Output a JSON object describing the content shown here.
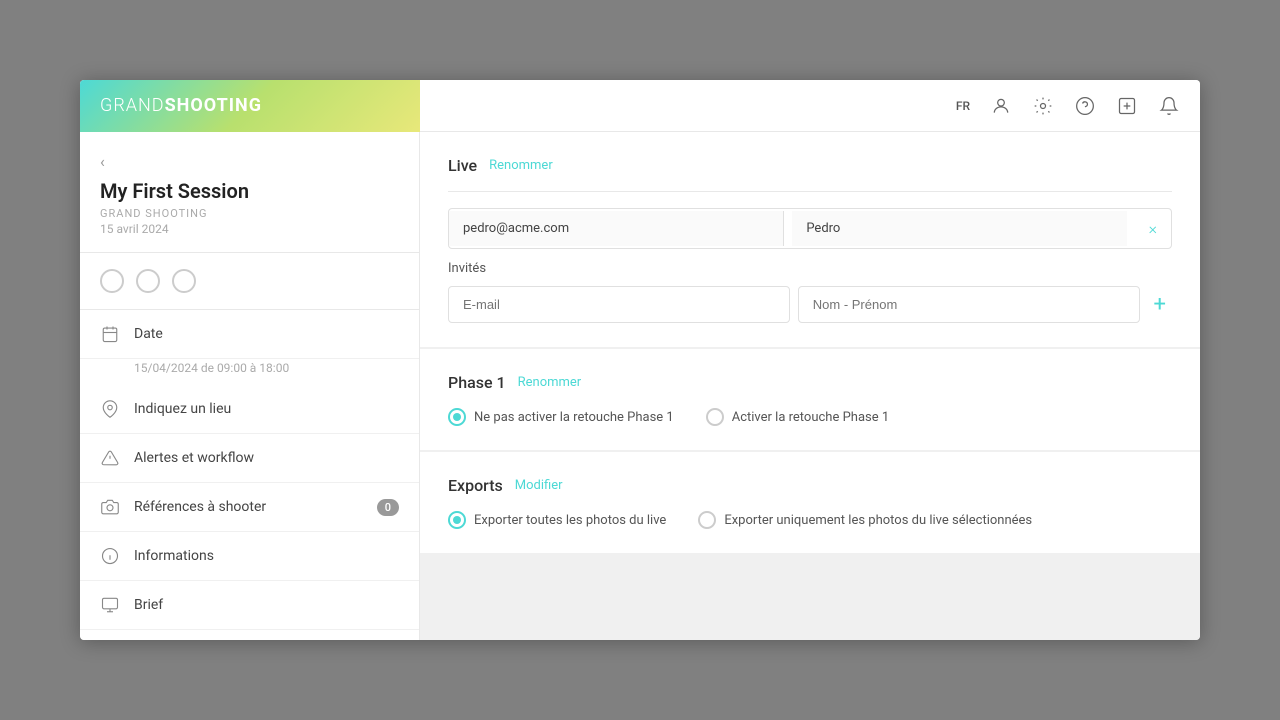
{
  "header": {
    "logo": {
      "part1": "GRAND",
      "part2": "SHOOTING"
    },
    "lang": "FR"
  },
  "sidebar": {
    "back_label": "‹",
    "session_title": "My First Session",
    "session_brand": "GRAND SHOOTING",
    "session_date": "15 avril 2024",
    "dots": [
      {
        "active": false
      },
      {
        "active": false
      },
      {
        "active": false
      }
    ],
    "nav_items": [
      {
        "id": "date",
        "label": "Date",
        "sub": "15/04/2024 de 09:00 à 18:00",
        "has_sub": true,
        "icon": "calendar"
      },
      {
        "id": "lieu",
        "label": "Indiquez un lieu",
        "has_sub": false,
        "icon": "map-pin"
      },
      {
        "id": "alertes",
        "label": "Alertes et workflow",
        "has_sub": false,
        "icon": "alert"
      },
      {
        "id": "references",
        "label": "Références à shooter",
        "badge": "0",
        "has_sub": false,
        "icon": "camera"
      },
      {
        "id": "informations",
        "label": "Informations",
        "has_sub": false,
        "icon": "info"
      },
      {
        "id": "brief",
        "label": "Brief",
        "has_sub": false,
        "icon": "monitor"
      }
    ]
  },
  "content": {
    "sections": [
      {
        "id": "live",
        "title": "Live",
        "action": "Renommer",
        "type": "invites",
        "existing_invite": {
          "email": "pedro@acme.com",
          "name": "Pedro"
        },
        "invites_label": "Invités",
        "email_placeholder": "E-mail",
        "name_placeholder": "Nom - Prénom"
      },
      {
        "id": "phase1",
        "title": "Phase 1",
        "action": "Renommer",
        "type": "radio",
        "options": [
          {
            "label": "Ne pas activer la retouche Phase 1",
            "selected": true
          },
          {
            "label": "Activer la retouche Phase 1",
            "selected": false
          }
        ]
      },
      {
        "id": "exports",
        "title": "Exports",
        "action": "Modifier",
        "type": "radio",
        "options": [
          {
            "label": "Exporter toutes les photos du live",
            "selected": true
          },
          {
            "label": "Exporter uniquement les photos du live sélectionnées",
            "selected": false
          }
        ]
      }
    ]
  }
}
